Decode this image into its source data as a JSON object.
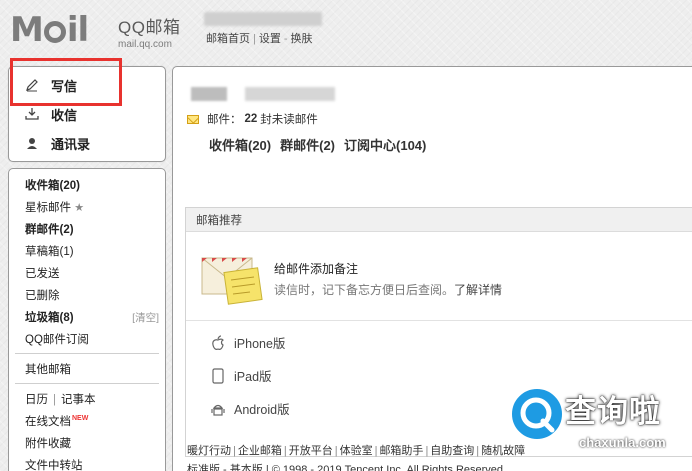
{
  "brand": {
    "logo_text": "M",
    "logo_text2": "il",
    "title": "QQ邮箱",
    "domain": "mail.qq.com"
  },
  "header": {
    "links": [
      "邮箱首页",
      "设置",
      "换肤"
    ]
  },
  "sidebar_top": {
    "compose": "写信",
    "inbox": "收信",
    "contacts": "通讯录"
  },
  "folders": {
    "inbox": "收件箱(20)",
    "starred": "星标邮件",
    "group": "群邮件(2)",
    "drafts": "草稿箱(1)",
    "sent": "已发送",
    "deleted": "已删除",
    "spam": "垃圾箱(8)",
    "spam_clear": "[清空]",
    "subscription": "QQ邮件订阅",
    "other": "其他邮箱",
    "calendar": "日历",
    "notes": "记事本",
    "docs": "在线文档",
    "docs_badge": "NEW",
    "favorites": "附件收藏",
    "transfer": "文件中转站"
  },
  "main": {
    "mail_label": "邮件：",
    "unread_count": "22",
    "unread_suffix": "封未读邮件",
    "quick_links": [
      "收件箱(20)",
      "群邮件(2)",
      "订阅中心(104)"
    ],
    "rec_title": "邮箱推荐",
    "note_title": "给邮件添加备注",
    "note_desc": "读信时，记下备忘方便日后查阅。",
    "note_link": "了解详情",
    "apps": [
      "iPhone版",
      "iPad版",
      "Android版"
    ],
    "footer": [
      "暖灯行动",
      "企业邮箱",
      "开放平台",
      "体验室",
      "邮箱助手",
      "自助查询",
      "随机故障"
    ],
    "footer2": "标准版 - 基本版 | © 1998 - 2019 Tencent Inc. All Rights Reserved"
  },
  "watermark": {
    "title": "查询啦",
    "sub": "chaxunla.com"
  },
  "colors": {
    "highlight": "#e8322e",
    "watermark_blue": "#1e9be3"
  }
}
